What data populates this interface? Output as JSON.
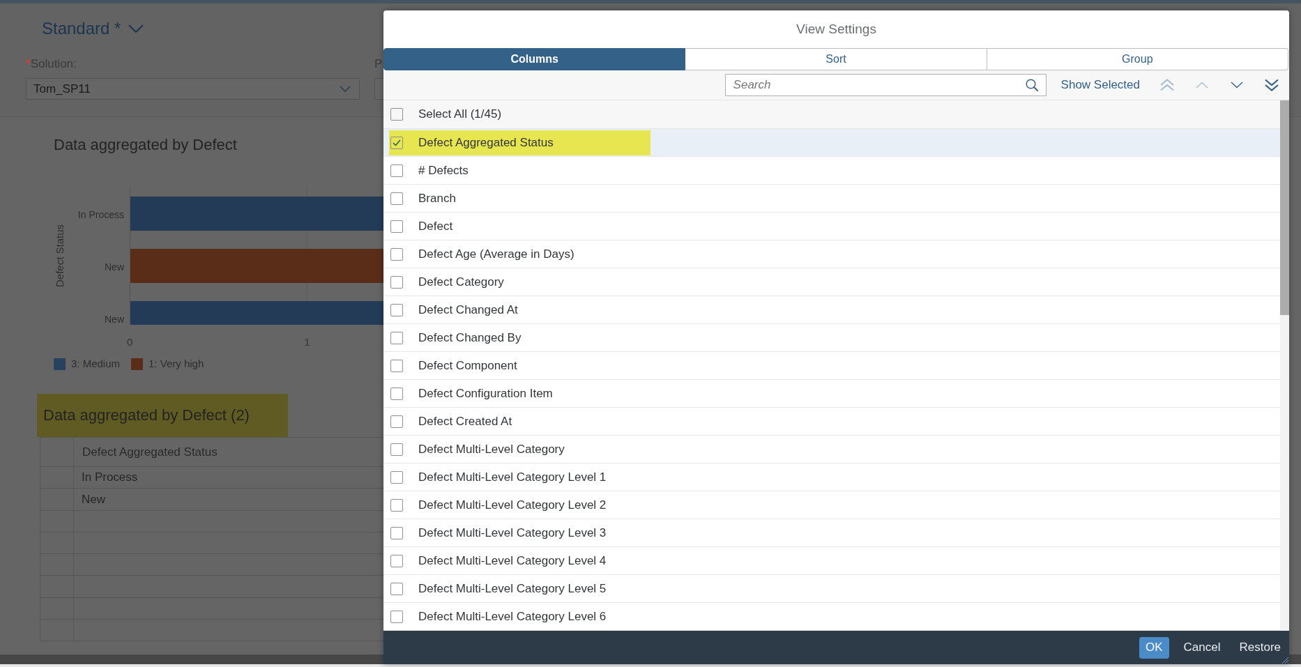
{
  "variant": {
    "title": "Standard *"
  },
  "filters": [
    {
      "required_mark": "*",
      "label": "Solution:",
      "value": "Tom_SP11"
    },
    {
      "label": "P"
    }
  ],
  "chart": {
    "title": "Data aggregated by Defect",
    "axis_title": "Defect Status",
    "bars": [
      {
        "label": "In Process",
        "color": "#233b57"
      },
      {
        "label": "New",
        "color": "#5a2d18"
      },
      {
        "label": "New",
        "color": "#233b57"
      }
    ],
    "ticks": [
      "0",
      "1"
    ],
    "legend": [
      {
        "label": "3: Medium",
        "color": "#27425f"
      },
      {
        "label": "1: Very high",
        "color": "#5a2d18"
      }
    ]
  },
  "table": {
    "title": "Data aggregated by Defect (2)",
    "highlighted": true,
    "columns": [
      "Defect Aggregated Status"
    ],
    "rows": [
      [
        "In Process"
      ],
      [
        "New"
      ]
    ]
  },
  "dialog": {
    "title": "View Settings",
    "tabs": [
      {
        "label": "Columns",
        "selected": true
      },
      {
        "label": "Sort",
        "selected": false
      },
      {
        "label": "Group",
        "selected": false
      }
    ],
    "search": {
      "placeholder": "Search"
    },
    "show_selected": "Show Selected",
    "move_buttons": [
      {
        "kind": "top",
        "disabled": true
      },
      {
        "kind": "up",
        "disabled": true
      },
      {
        "kind": "down",
        "disabled": false
      },
      {
        "kind": "bottom",
        "disabled": false
      }
    ],
    "select_all": {
      "label": "Select All (1/45)",
      "checked": false
    },
    "items": [
      {
        "label": "Defect Aggregated Status",
        "checked": true,
        "highlighted": true
      },
      {
        "label": "# Defects",
        "checked": false,
        "highlighted": false
      },
      {
        "label": "Branch",
        "checked": false,
        "highlighted": false
      },
      {
        "label": "Defect",
        "checked": false,
        "highlighted": false
      },
      {
        "label": "Defect Age (Average in Days)",
        "checked": false,
        "highlighted": false
      },
      {
        "label": "Defect Category",
        "checked": false,
        "highlighted": false
      },
      {
        "label": "Defect Changed At",
        "checked": false,
        "highlighted": false
      },
      {
        "label": "Defect Changed By",
        "checked": false,
        "highlighted": false
      },
      {
        "label": "Defect Component",
        "checked": false,
        "highlighted": false
      },
      {
        "label": "Defect Configuration Item",
        "checked": false,
        "highlighted": false
      },
      {
        "label": "Defect Created At",
        "checked": false,
        "highlighted": false
      },
      {
        "label": "Defect Multi-Level Category",
        "checked": false,
        "highlighted": false
      },
      {
        "label": "Defect Multi-Level Category Level 1",
        "checked": false,
        "highlighted": false
      },
      {
        "label": "Defect Multi-Level Category Level 2",
        "checked": false,
        "highlighted": false
      },
      {
        "label": "Defect Multi-Level Category Level 3",
        "checked": false,
        "highlighted": false
      },
      {
        "label": "Defect Multi-Level Category Level 4",
        "checked": false,
        "highlighted": false
      },
      {
        "label": "Defect Multi-Level Category Level 5",
        "checked": false,
        "highlighted": false
      },
      {
        "label": "Defect Multi-Level Category Level 6",
        "checked": false,
        "highlighted": false
      }
    ],
    "buttons": [
      {
        "label": "OK",
        "kind": "emphasized"
      },
      {
        "label": "Cancel",
        "kind": "transparent"
      },
      {
        "label": "Restore",
        "kind": "transparent"
      }
    ]
  }
}
